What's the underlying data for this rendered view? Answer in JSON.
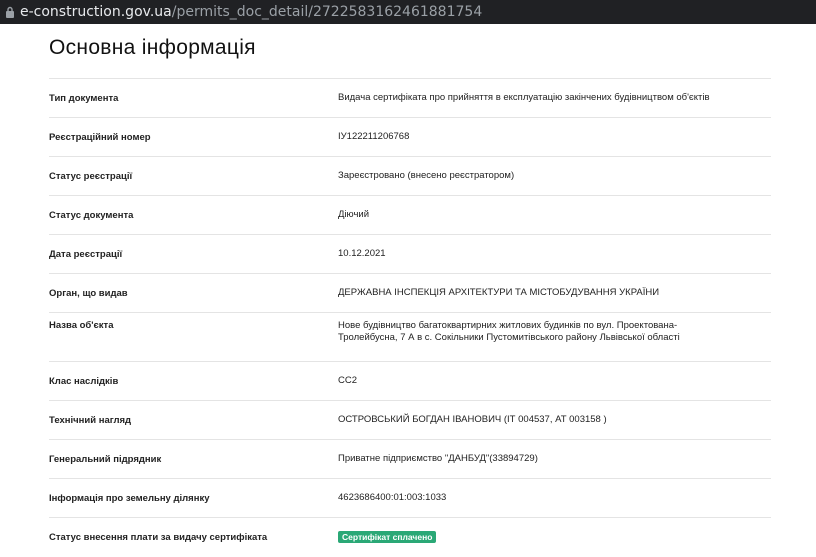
{
  "browser": {
    "url_host": "e-construction.gov.ua",
    "url_path": "/permits_doc_detail/2722583162461881754"
  },
  "section": {
    "title": "Основна інформація"
  },
  "rows": [
    {
      "label": "Тип документа",
      "value": "Видача сертифіката про прийняття в експлуатацію закінчених будівництвом об'єктів"
    },
    {
      "label": "Реєстраційний номер",
      "value": "ІУ122211206768"
    },
    {
      "label": "Статус реєстрації",
      "value": "Зареєстровано (внесено реєстратором)"
    },
    {
      "label": "Статус документа",
      "value": "Діючий"
    },
    {
      "label": "Дата реєстрації",
      "value": "10.12.2021"
    },
    {
      "label": "Орган, що видав",
      "value": "ДЕРЖАВНА ІНСПЕКЦІЯ АРХІТЕКТУРИ ТА МІСТОБУДУВАННЯ УКРАЇНИ"
    },
    {
      "label": "Назва об'єкта",
      "value_line1": "Нове будівництво багатоквартирних житлових будинків по вул. Проектована-",
      "value_line2": "Тролейбусна, 7 А в с. Сокільники Пустомитівського району Львівської області"
    },
    {
      "label": "Клас наслідків",
      "value": "СС2"
    },
    {
      "label": "Технічний нагляд",
      "value": "ОСТРОВСЬКИЙ БОГДАН ІВАНОВИЧ (ІТ 004537, АТ 003158 )"
    },
    {
      "label": "Генеральний підрядник",
      "value": "Приватне підприємство \"ДАНБУД\"(33894729)"
    },
    {
      "label": "Інформація про земельну ділянку",
      "value": "4623686400:01:003:1033"
    },
    {
      "label": "Статус внесення плати за видачу сертифіката",
      "badge": "Сертифікат сплачено",
      "badge_color": "#2aa876"
    }
  ]
}
